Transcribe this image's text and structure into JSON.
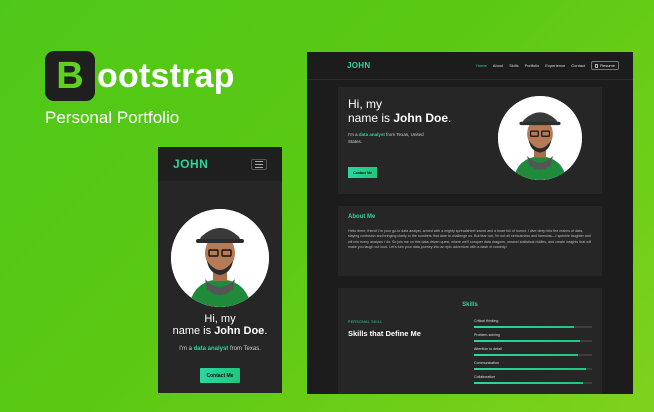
{
  "branding": {
    "logo_letter": "B",
    "name": "ootstrap",
    "subtitle": "Personal Portfolio"
  },
  "mobile": {
    "logo": "JOHN",
    "greeting_line1": "Hi, my",
    "greeting_prefix": "name is ",
    "greeting_name": "John Doe",
    "greeting_suffix": ".",
    "role_prefix": "I'm a ",
    "role_highlight": "data analyst",
    "role_suffix": " from Texas.",
    "contact_button": "Contact Me"
  },
  "desktop": {
    "logo": "JOHN",
    "nav_links": [
      "Home",
      "About",
      "Skills",
      "Portfolio",
      "Experience",
      "Contact"
    ],
    "active_link": "Home",
    "resume_button": "Resume",
    "greeting_line1": "Hi, my",
    "greeting_prefix": "name is ",
    "greeting_name": "John Doe",
    "greeting_suffix": ".",
    "role_prefix": "I'm a ",
    "role_highlight": "data analyst",
    "role_suffix": " from Texas, United States.",
    "contact_button": "Contact Me",
    "about": {
      "title": "About Me",
      "text": "Hello there, friend! I'm your go-to data analyst, armed with a mighty spreadsheet sword and a heart full of humor. I dive deep into the realms of data, slaying confusion and bringing clarity to the numbers that dare to challenge us. But fear not, I'm not all seriousness and formulas—I sprinkle laughter and wit into every analysis I do. So join me on this data-driven quest, where we'll conquer data dragons, unravel statistical riddles, and create insights that will make you laugh out loud. Let's turn your data journey into an epic adventure with a dash of comedy!"
    },
    "skills": {
      "title": "Skills",
      "kicker": "PERSONAL SKILL",
      "heading": "Skills that Define Me",
      "items": [
        {
          "name": "Critical thinking",
          "level": 0.85
        },
        {
          "name": "Problem-solving",
          "level": 0.9
        },
        {
          "name": "Attention to detail",
          "level": 0.88
        },
        {
          "name": "Communication",
          "level": 0.95
        },
        {
          "name": "Collaboration",
          "level": 0.92
        }
      ]
    }
  },
  "colors": {
    "accent": "#2bd6a0",
    "background": "#5ac913",
    "card": "#262626"
  }
}
